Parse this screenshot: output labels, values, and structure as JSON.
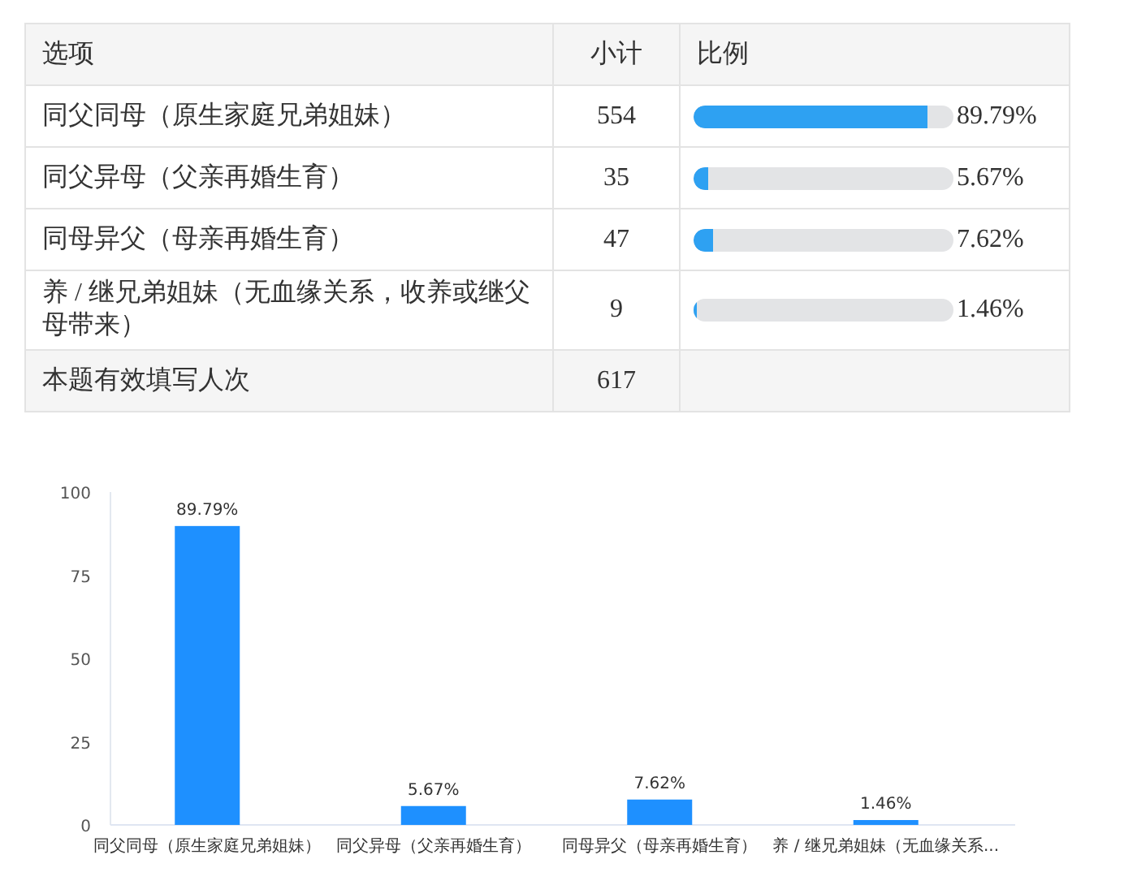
{
  "table": {
    "columns": [
      "选项",
      "小计",
      "比例"
    ],
    "rows": [
      {
        "option": "同父同母（原生家庭兄弟姐妹）",
        "count": "554",
        "level": 0.8979,
        "percent": "89.79%"
      },
      {
        "option": "同父异母（父亲再婚生育）",
        "count": "35",
        "level": 0.0567,
        "percent": "5.67%"
      },
      {
        "option": "同母异父（母亲再婚生育）",
        "count": "47",
        "level": 0.0762,
        "percent": "7.62%"
      },
      {
        "option": "养 / 继兄弟姐妹（无血缘关系，收养或继父母带来）",
        "count": "9",
        "level": 0.0146,
        "percent": "1.46%"
      }
    ],
    "total": {
      "label": "本题有效填写人次",
      "count": "617"
    }
  },
  "chart": {
    "chart_data": {
      "type": "bar",
      "categories": [
        "同父同母（原生家庭兄弟姐妹）",
        "同父异母（父亲再婚生育）",
        "同母异父（母亲再婚生育）",
        "养 / 继兄弟姐妹（无血缘关系..."
      ],
      "series": [
        {
          "color": "#1e90ff",
          "values": [
            89.79,
            5.67,
            7.62,
            1.46
          ]
        }
      ],
      "ylim": [
        0,
        100
      ],
      "yticks": [
        0,
        25,
        50,
        75,
        100
      ],
      "value_labels": [
        "89.79%",
        "5.67%",
        "7.62%",
        "1.46%"
      ]
    }
  }
}
